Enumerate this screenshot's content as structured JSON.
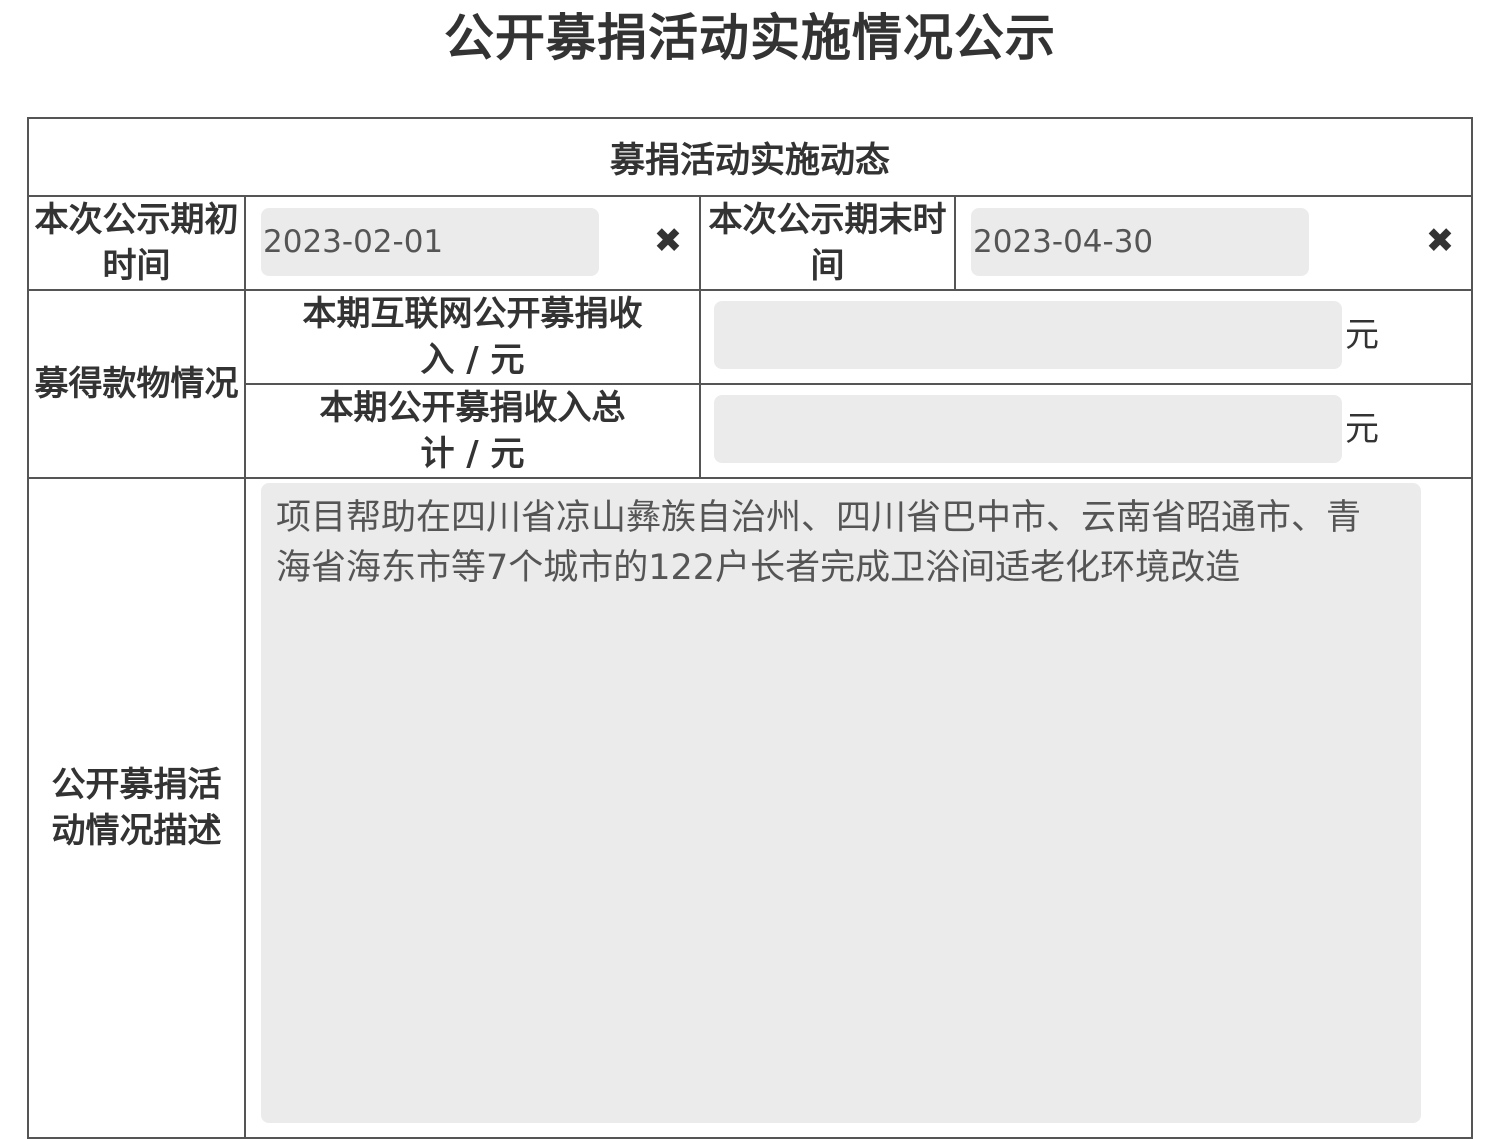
{
  "page": {
    "title": "公开募捐活动实施情况公示"
  },
  "section": {
    "header": "募捐活动实施动态"
  },
  "period": {
    "start_label": "本次公示期初时间",
    "start_value": "2023-02-01",
    "end_label": "本次公示期末时间",
    "end_value": "2023-04-30",
    "clear_icon": "close-x-icon"
  },
  "funds": {
    "group_label": "募得款物情况",
    "internet_income_label": "本期互联网公开募捐收入 / 元",
    "internet_income_value": "",
    "internet_income_unit": "元",
    "total_income_label": "本期公开募捐收入总计 / 元",
    "total_income_value": "",
    "total_income_unit": "元"
  },
  "description": {
    "label": "公开募捐活动情况描述",
    "value": "项目帮助在四川省凉山彝族自治州、四川省巴中市、云南省昭通市、青海省海东市等7个城市的122户长者完成卫浴间适老化环境改造"
  },
  "colors": {
    "text": "#333333",
    "field_bg": "#ebebeb",
    "border": "#555555"
  }
}
